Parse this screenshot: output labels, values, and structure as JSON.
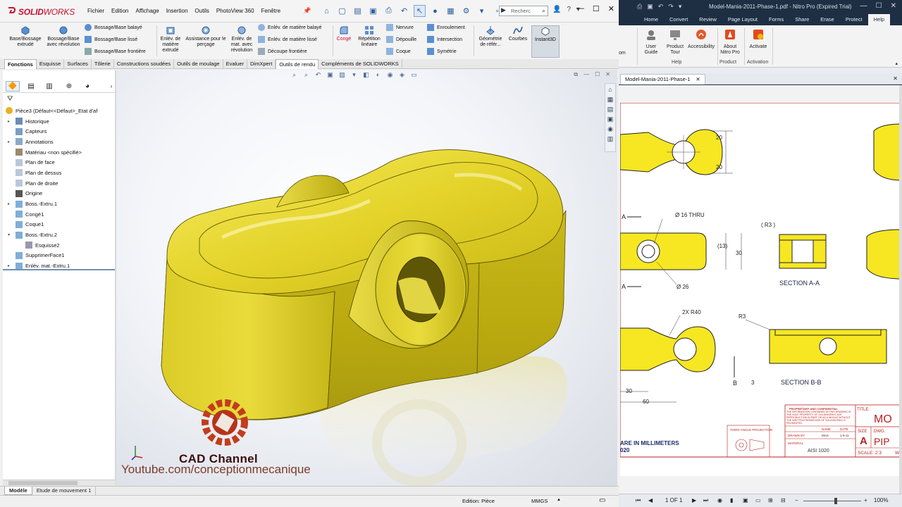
{
  "solidworks": {
    "logo": {
      "solid": "SOLID",
      "works": "WORKS"
    },
    "menu": [
      "Fichier",
      "Edition",
      "Affichage",
      "Insertion",
      "Outils",
      "PhotoView 360",
      "Fenêtre"
    ],
    "search_placeholder": "Recherc",
    "help_label": "?",
    "commands": {
      "base_bossage_extrude": "Base/Bossage extrudé",
      "bossage_base_revolution": "Bossage/Base avec révolution",
      "bossage_balaye": "Bossage/Base balayé",
      "bossage_lisse": "Bossage/Base lissé",
      "bossage_frontiere": "Bossage/Base frontière",
      "enlev_extrude": "Enlév. de matière extrudé",
      "assistance_percage": "Assistance pour le perçage",
      "enlev_revolution": "Enlév. de mat. avec révolution",
      "enlev_balaye": "Enlév. de matière balayé",
      "enlev_lisse": "Enlév. de matière lissé",
      "decoupe_frontiere": "Découpe frontière",
      "conge": "Congé",
      "repetition_lineaire": "Répétition linéaire",
      "nervure": "Nervure",
      "depouille": "Dépouille",
      "coque": "Coque",
      "enroulement": "Enroulement",
      "intersection": "Intersection",
      "symetrie": "Symétrie",
      "geometrie_ref": "Géométrie de référ...",
      "courbes": "Courbes",
      "instant3d": "Instant3D"
    },
    "tabs": [
      "Fonctions",
      "Esquisse",
      "Surfaces",
      "Tôlerie",
      "Constructions soudées",
      "Outils de moulage",
      "Evaluer",
      "DimXpert",
      "Outils de rendu",
      "Compléments de SOLIDWORKS"
    ],
    "active_tab": "Fonctions",
    "tree": [
      {
        "label": "Pièce3  (Défaut<<Défaut>_Etat d'af",
        "icon": "part-icon",
        "level": 0,
        "expand": false
      },
      {
        "label": "Historique",
        "icon": "history-icon",
        "level": 1,
        "expand": true
      },
      {
        "label": "Capteurs",
        "icon": "sensor-icon",
        "level": 1,
        "expand": false
      },
      {
        "label": "Annotations",
        "icon": "annotation-icon",
        "level": 1,
        "expand": true
      },
      {
        "label": "Matériau <non spécifié>",
        "icon": "material-icon",
        "level": 1,
        "expand": false
      },
      {
        "label": "Plan de face",
        "icon": "plane-icon",
        "level": 1,
        "expand": false
      },
      {
        "label": "Plan de dessus",
        "icon": "plane-icon",
        "level": 1,
        "expand": false
      },
      {
        "label": "Plan de droite",
        "icon": "plane-icon",
        "level": 1,
        "expand": false
      },
      {
        "label": "Origine",
        "icon": "origin-icon",
        "level": 1,
        "expand": false
      },
      {
        "label": "Boss.-Extru.1",
        "icon": "extrude-icon",
        "level": 1,
        "expand": true
      },
      {
        "label": "Congé1",
        "icon": "fillet-icon",
        "level": 1,
        "expand": false
      },
      {
        "label": "Coque1",
        "icon": "shell-icon",
        "level": 1,
        "expand": false
      },
      {
        "label": "Boss.-Extru.2",
        "icon": "extrude-icon",
        "level": 1,
        "expand": true,
        "open": true
      },
      {
        "label": "Esquisse2",
        "icon": "sketch-icon",
        "level": 2,
        "expand": false
      },
      {
        "label": "SupprimerFace1",
        "icon": "deleteface-icon",
        "level": 1,
        "expand": false
      },
      {
        "label": "Enlév. mat.-Extru.1",
        "icon": "cut-icon",
        "level": 1,
        "expand": true
      }
    ],
    "watermark": {
      "channel": "CAD Channel",
      "url": "Youtube.com/conceptionmecanique"
    },
    "bottom_tabs": [
      "Modèle",
      "Etude de mouvement 1"
    ],
    "status": {
      "edition": "Edition: Pièce",
      "units": "MMGS"
    },
    "colors": {
      "part_yellow": "#e6d428",
      "accent_red": "#c8102e"
    }
  },
  "nitro": {
    "title": "Model-Mania-2011-Phase-1.pdf - Nitro Pro (Expired Trial)",
    "tabs": [
      "Home",
      "Convert",
      "Review",
      "Page Layout",
      "Forms",
      "Share",
      "Erase",
      "Protect",
      "Help"
    ],
    "active_tab": "Help",
    "ribbon": {
      "user_guide": "User Guide",
      "product_tour": "Product Tour",
      "accessibility": "Accessibility",
      "about": "About Nitro Pro",
      "activate": "Activate",
      "group_help": "Help",
      "group_product": "Product",
      "group_activation": "Activation",
      "left_fragment": "om"
    },
    "doc_tab": "Model-Mania-2011-Phase-1",
    "drawing": {
      "dim_20a": "20",
      "dim_20b": "20",
      "thru_hole": "Ø 16 THRU",
      "dim_13": "(13)",
      "dim_30": "30",
      "dim_26": "Ø 26",
      "section_a": "A",
      "section_a2": "A",
      "r3": "( R3 )",
      "section_aa": "SECTION A-A",
      "r40": "2X R40",
      "r3b": "R3",
      "dim_30b": "30",
      "dim_60": "60",
      "dim_3": "3",
      "section_b": "B",
      "section_bb": "SECTION B-B",
      "units_note": "ARE IN MILLIMETERS",
      "units_note2": "020",
      "title_label": "TITLE:",
      "title_value": "MO",
      "proprietary": "PROPRIETARY AND CONFIDENTIAL",
      "proprietary_text": "THE INFORMATION CONTAINED IN THIS DRAWING IS THE SOLE PROPERTY OF SOLIDWORKS. ANY REPRODUCTION IN PART OR AS A WHOLE WITHOUT THE WRITTEN PERMISSION OF SOLIDWORKS IS PROHIBITED.",
      "name_h": "NAME",
      "date_h": "DATE",
      "drawn_by": "DRAWN BY",
      "drawn_name": "MAS",
      "drawn_date": "1-5-11",
      "material_label": "MATERIAL",
      "material": "AISI 1020",
      "size_label": "SIZE",
      "size": "A",
      "dwg_label": "DWG.",
      "dwg": "PIP",
      "scale": "SCALE: 2:3",
      "third_angle": "THIRD ANGLE PROJECTION",
      "w": "W"
    },
    "status": {
      "page": "1 OF 1",
      "zoom": "100%"
    }
  }
}
